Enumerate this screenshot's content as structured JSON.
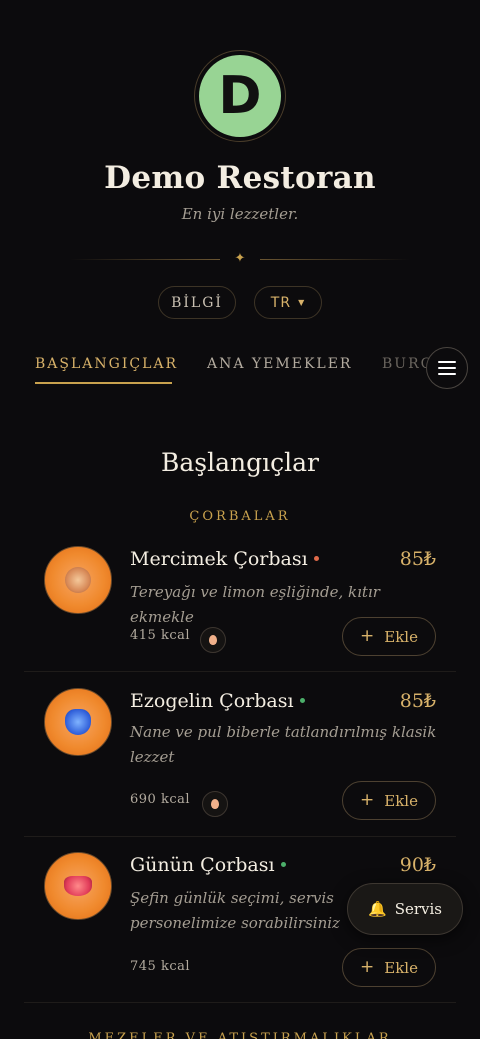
{
  "restaurant": {
    "logo_letter": "D",
    "name": "Demo Restoran",
    "tagline": "En iyi lezzetler."
  },
  "controls": {
    "info_label": "BİLGİ",
    "language": "TR"
  },
  "tabs": [
    {
      "label": "BAŞLANGIÇLAR",
      "active": true
    },
    {
      "label": "ANA YEMEKLER",
      "active": false
    },
    {
      "label": "BURGER",
      "active": false
    }
  ],
  "section": {
    "title": "Başlangıçlar",
    "categories": [
      "ÇORBALAR",
      "MEZELER VE ATIŞTIRMALIKLAR"
    ]
  },
  "items": [
    {
      "name": "Mercimek Çorbası",
      "price": "85₺",
      "description": "Tereyağı ve limon eşliğinde, kıtır ekmekle",
      "kcal": "415 kcal",
      "dot_color": "#e06a4a",
      "add_label": "Ekle"
    },
    {
      "name": "Ezogelin Çorbası",
      "price": "85₺",
      "description": "Nane ve pul biberle tatlandırılmış klasik lezzet",
      "kcal": "690 kcal",
      "dot_color": "#4caf6a",
      "add_label": "Ekle"
    },
    {
      "name": "Günün Çorbası",
      "price": "90₺",
      "description": "Şefin günlük seçimi, servis personelimize sorabilirsiniz",
      "kcal": "745 kcal",
      "dot_color": "#4caf6a",
      "add_label": "Ekle"
    }
  ],
  "service_button": {
    "label": "Servis",
    "icon": "bell-icon"
  },
  "colors": {
    "accent": "#c9a24e",
    "background": "#0c0b0d",
    "logo": "#98d494"
  }
}
